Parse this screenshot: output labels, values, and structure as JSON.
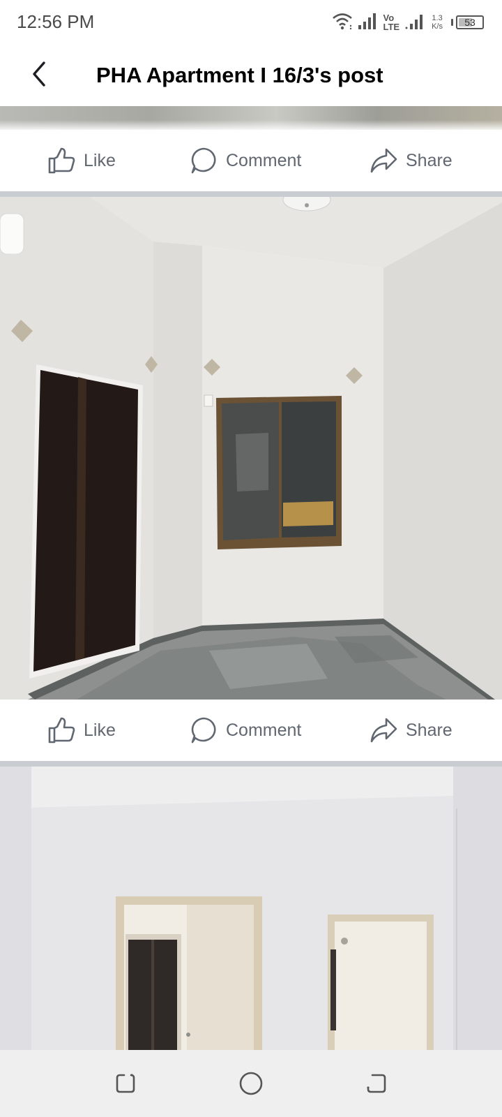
{
  "status_bar": {
    "time": "12:56 PM",
    "volte_top": "Vo",
    "volte_bottom": "LTE",
    "net_speed_value": "1.3",
    "net_speed_unit": "K/s",
    "battery_level": "53",
    "icons": [
      "wifi-icon",
      "signal-icon",
      "signal-icon",
      "battery-icon"
    ]
  },
  "header": {
    "title": "PHA Apartment  I 16/3's post",
    "back_icon": "chevron-left-icon"
  },
  "action_bars": [
    {
      "like": "Like",
      "comment": "Comment",
      "share": "Share"
    },
    {
      "like": "Like",
      "comment": "Comment",
      "share": "Share"
    }
  ],
  "nav_bar": {
    "icons": [
      "recent-apps-icon",
      "home-icon",
      "back-icon"
    ]
  },
  "colors": {
    "action_text": "#606770",
    "divider": "#c9ccd1",
    "nav_bg": "#efefef"
  }
}
